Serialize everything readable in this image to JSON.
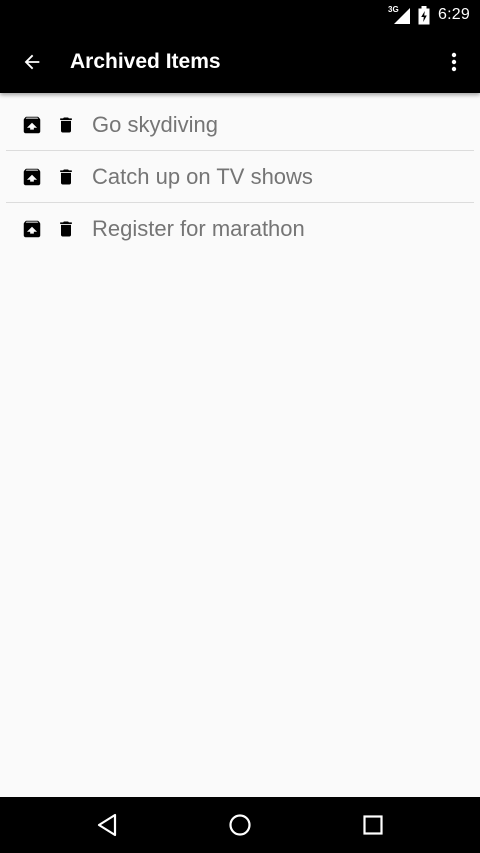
{
  "status_bar": {
    "network": "3G",
    "time": "6:29"
  },
  "app_bar": {
    "title": "Archived Items"
  },
  "items": [
    {
      "text": "Go skydiving"
    },
    {
      "text": "Catch up on TV shows"
    },
    {
      "text": "Register for marathon"
    }
  ],
  "colors": {
    "app_bar_bg": "#000000",
    "background": "#fafafa",
    "item_text": "#757575",
    "divider": "#dcdcdc"
  },
  "icons": {
    "back": "arrow-left-icon",
    "overflow": "more-vert-icon",
    "unarchive": "unarchive-icon",
    "delete": "trash-icon",
    "nav_back": "triangle-back-icon",
    "nav_home": "circle-home-icon",
    "nav_recents": "square-recents-icon"
  }
}
